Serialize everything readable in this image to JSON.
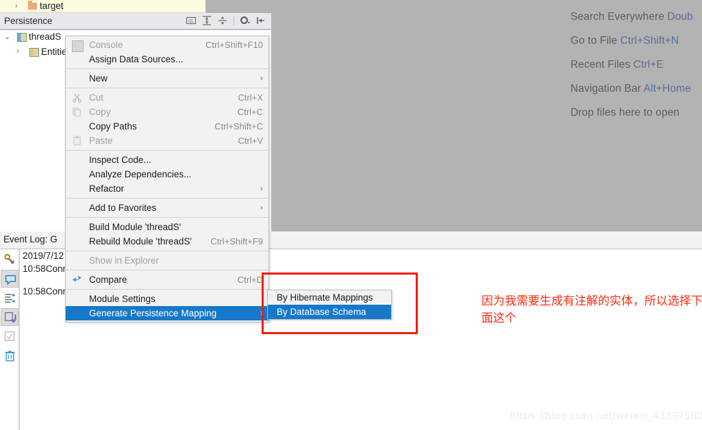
{
  "project_tree": {
    "top_row": {
      "label": "target",
      "expander": "›",
      "icon": "folder-icon"
    }
  },
  "persistence_panel": {
    "title": "Persistence",
    "toolbar": [
      {
        "name": "sql-console-icon",
        "tooltip": "Open Console"
      },
      {
        "name": "expand-all-icon",
        "tooltip": "Expand All"
      },
      {
        "name": "collapse-all-icon",
        "tooltip": "Collapse All"
      },
      {
        "name": "settings-gear-icon",
        "tooltip": "Settings"
      },
      {
        "name": "hide-panel-icon",
        "tooltip": "Hide"
      }
    ],
    "tree": [
      {
        "label": "threadS",
        "expander": "⌄",
        "icon": "module-icon",
        "indent": 0
      },
      {
        "label": "Entitie",
        "expander": "›",
        "icon": "entities-icon",
        "indent": 1
      }
    ]
  },
  "editor_hints": [
    {
      "label": "Search Everywhere ",
      "key": "Doub"
    },
    {
      "label": "Go to File ",
      "key": "Ctrl+Shift+N"
    },
    {
      "label": "Recent Files ",
      "key": "Ctrl+E"
    },
    {
      "label": "Navigation Bar ",
      "key": "Alt+Home"
    },
    {
      "label": "Drop files here to open",
      "key": ""
    }
  ],
  "context_menu": {
    "items": [
      {
        "label": "Console",
        "accel": "Ctrl+Shift+F10",
        "disabled": true,
        "icon": "console-icon",
        "submenu": false,
        "selected": false
      },
      {
        "label": "Assign Data Sources...",
        "accel": "",
        "disabled": false,
        "icon": "",
        "submenu": false,
        "selected": false
      },
      {
        "separator": true
      },
      {
        "label": "New",
        "accel": "",
        "disabled": false,
        "icon": "",
        "submenu": true,
        "selected": false
      },
      {
        "separator": true
      },
      {
        "label": "Cut",
        "accel": "Ctrl+X",
        "disabled": true,
        "icon": "cut-icon",
        "submenu": false,
        "selected": false
      },
      {
        "label": "Copy",
        "accel": "Ctrl+C",
        "disabled": true,
        "icon": "copy-icon",
        "submenu": false,
        "selected": false
      },
      {
        "label": "Copy Paths",
        "accel": "Ctrl+Shift+C",
        "disabled": false,
        "icon": "",
        "submenu": false,
        "selected": false
      },
      {
        "label": "Paste",
        "accel": "Ctrl+V",
        "disabled": true,
        "icon": "paste-icon",
        "submenu": false,
        "selected": false
      },
      {
        "separator": true
      },
      {
        "label": "Inspect Code...",
        "accel": "",
        "disabled": false,
        "icon": "",
        "submenu": false,
        "selected": false
      },
      {
        "label": "Analyze Dependencies...",
        "accel": "",
        "disabled": false,
        "icon": "",
        "submenu": false,
        "selected": false
      },
      {
        "label": "Refactor",
        "accel": "",
        "disabled": false,
        "icon": "",
        "submenu": true,
        "selected": false
      },
      {
        "separator": true
      },
      {
        "label": "Add to Favorites",
        "accel": "",
        "disabled": false,
        "icon": "",
        "submenu": true,
        "selected": false
      },
      {
        "separator": true
      },
      {
        "label": "Build Module 'threadS'",
        "accel": "",
        "disabled": false,
        "icon": "",
        "submenu": false,
        "selected": false
      },
      {
        "label": "Rebuild Module 'threadS'",
        "accel": "Ctrl+Shift+F9",
        "disabled": false,
        "icon": "",
        "submenu": false,
        "selected": false
      },
      {
        "separator": true
      },
      {
        "label": "Show in Explorer",
        "accel": "",
        "disabled": true,
        "icon": "",
        "submenu": false,
        "selected": false
      },
      {
        "separator": true
      },
      {
        "label": "Compare",
        "accel": "Ctrl+D",
        "disabled": false,
        "icon": "compare-icon",
        "submenu": false,
        "selected": false
      },
      {
        "separator": true
      },
      {
        "label": "Module Settings",
        "accel": "",
        "disabled": false,
        "icon": "",
        "submenu": false,
        "selected": false
      },
      {
        "label": "Generate Persistence Mapping",
        "accel": "",
        "disabled": false,
        "icon": "",
        "submenu": true,
        "selected": true
      }
    ]
  },
  "submenu": {
    "items": [
      {
        "label": "By Hibernate Mappings",
        "selected": false
      },
      {
        "label": "By Database Schema",
        "selected": true
      }
    ]
  },
  "annotation": {
    "text": "因为我需要生成有注解的实体，所以选择下面这个",
    "color": "#fd2b12",
    "box_color": "#f51b0b"
  },
  "event_log": {
    "header": "Event Log:    G",
    "lines": [
      "2019/7/12",
      "10:58Conn"
    ],
    "lines2": [
      "10:58Conn"
    ],
    "sidebar_buttons": [
      {
        "name": "settings-wrench-icon",
        "active": false
      },
      {
        "name": "speech-bubble-icon",
        "active": true
      },
      {
        "name": "expand-filter-icon",
        "active": false
      },
      {
        "name": "soft-wrap-icon",
        "active": true
      },
      {
        "name": "checkbox-icon",
        "active": false
      },
      {
        "name": "trash-icon",
        "active": false
      }
    ]
  },
  "watermark": "https://blog.csdn.net/weixin_43397580",
  "colors": {
    "editor_bg": "#b3b3b3",
    "menu_bg": "#f2f2f2",
    "selection_blue": "#1778c9",
    "hint_key": "#5c6b9e",
    "annotation_red": "#fd2b12"
  }
}
